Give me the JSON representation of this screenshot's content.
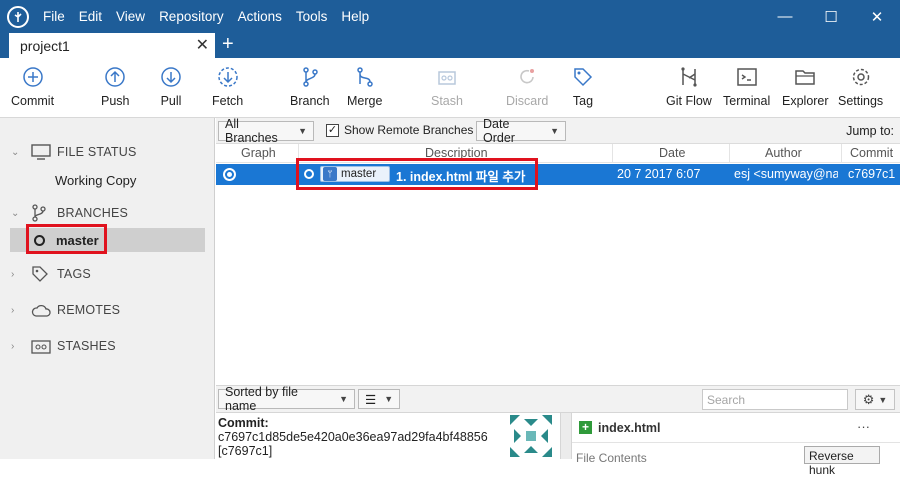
{
  "menu": [
    "File",
    "Edit",
    "View",
    "Repository",
    "Actions",
    "Tools",
    "Help"
  ],
  "window_controls": {
    "minimize": "—",
    "maximize": "☐",
    "close": "✕"
  },
  "tab": {
    "title": "project1",
    "close": "✕",
    "add": "+"
  },
  "toolbar": {
    "commit": "Commit",
    "push": "Push",
    "pull": "Pull",
    "fetch": "Fetch",
    "branch": "Branch",
    "merge": "Merge",
    "stash": "Stash",
    "discard": "Discard",
    "tag": "Tag",
    "gitflow": "Git Flow",
    "terminal": "Terminal",
    "explorer": "Explorer",
    "settings": "Settings"
  },
  "sidebar": {
    "file_status": "FILE STATUS",
    "working_copy": "Working Copy",
    "branches": "BRANCHES",
    "master": "master",
    "tags": "TAGS",
    "remotes": "REMOTES",
    "stashes": "STASHES"
  },
  "filter": {
    "branches_dropdown": "All Branches",
    "show_remote": "Show Remote Branches",
    "order_dropdown": "Date Order",
    "jump_to": "Jump to:"
  },
  "columns": {
    "graph": "Graph",
    "description": "Description",
    "date": "Date",
    "author": "Author",
    "commit": "Commit"
  },
  "commit_row": {
    "branch": "master",
    "message": "1. index.html 파일 추가",
    "date": "20 7 2017 6:07",
    "author": "esj <sumyway@na",
    "hash": "c7697c1"
  },
  "bottom": {
    "sort": "Sorted by file name",
    "search_placeholder": "Search"
  },
  "details": {
    "label": "Commit:",
    "full_hash": "c7697c1d85de5e420a0e36ea97ad29fa4bf48856",
    "short_hash": "[c7697c1]"
  },
  "file_panel": {
    "filename": "index.html",
    "more": "···",
    "contents_label": "File Contents",
    "reverse_hunk": "Reverse hunk"
  },
  "colors": {
    "titlebar": "#1e5d99",
    "selection": "#1a77d4",
    "highlight": "#e0121e"
  }
}
